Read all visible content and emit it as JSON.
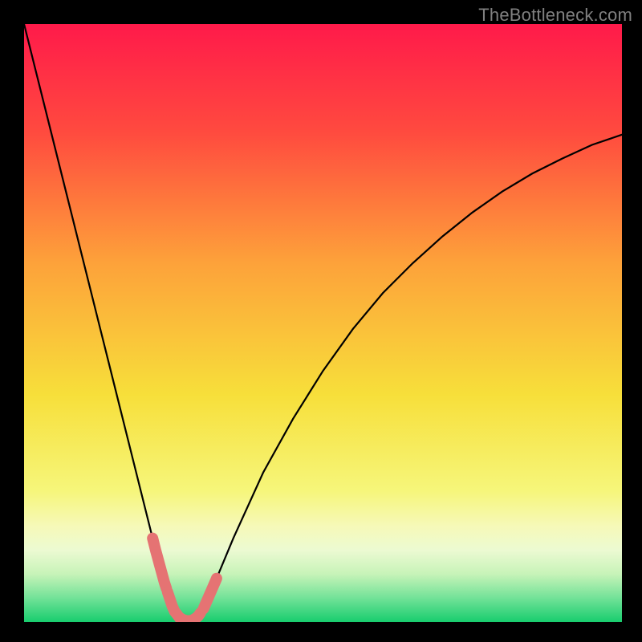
{
  "watermark": "TheBottleneck.com",
  "chart_data": {
    "type": "line",
    "title": "",
    "xlabel": "",
    "ylabel": "",
    "xlim": [
      0,
      100
    ],
    "ylim": [
      0,
      100
    ],
    "x": [
      0,
      2,
      4,
      6,
      8,
      10,
      12,
      14,
      16,
      18,
      20,
      22,
      23.5,
      25,
      26,
      27,
      28,
      29,
      30,
      32,
      35,
      40,
      45,
      50,
      55,
      60,
      65,
      70,
      75,
      80,
      85,
      90,
      95,
      100
    ],
    "y": [
      100,
      92,
      84,
      76,
      68,
      60,
      52,
      44,
      36,
      28,
      20,
      12,
      6.5,
      2,
      0.7,
      0.2,
      0.2,
      0.8,
      2.2,
      6.8,
      14,
      25,
      34,
      42,
      49,
      55,
      60,
      64.5,
      68.5,
      72,
      75,
      77.5,
      79.8,
      81.5
    ],
    "annotations": [
      {
        "type": "marker-segment",
        "x_range": [
          21.5,
          23.8
        ],
        "color": "#e57373"
      },
      {
        "type": "marker-segment",
        "x_range": [
          24,
          29.5
        ],
        "color": "#e57373"
      },
      {
        "type": "marker-segment",
        "x_range": [
          30,
          32.2
        ],
        "color": "#e57373"
      }
    ],
    "gradient_stops": [
      {
        "pct": 0,
        "color": "#ff1a4a"
      },
      {
        "pct": 18,
        "color": "#ff4a3f"
      },
      {
        "pct": 40,
        "color": "#fda23a"
      },
      {
        "pct": 62,
        "color": "#f7df3a"
      },
      {
        "pct": 78,
        "color": "#f6f67a"
      },
      {
        "pct": 84,
        "color": "#f6f9b8"
      },
      {
        "pct": 88,
        "color": "#ecfad2"
      },
      {
        "pct": 92,
        "color": "#c7f3b8"
      },
      {
        "pct": 96,
        "color": "#72e298"
      },
      {
        "pct": 100,
        "color": "#18cd6e"
      }
    ]
  }
}
